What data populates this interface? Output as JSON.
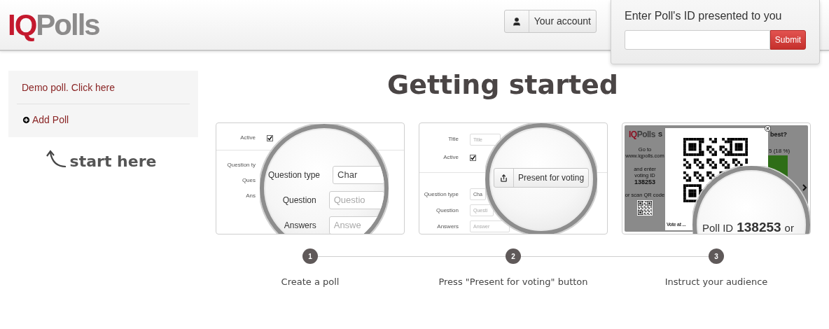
{
  "header": {
    "logo": {
      "accent": "IQ",
      "rest": "Polls"
    },
    "account_button": "Your account",
    "poll_entry": {
      "label": "Enter Poll's ID presented to you",
      "submit": "Submit"
    }
  },
  "sidebar": {
    "items": [
      {
        "kind": "link",
        "label": "Demo poll. Click here"
      },
      {
        "kind": "add",
        "label": "Add Poll"
      }
    ],
    "hint": "start here"
  },
  "title": "Getting started",
  "steps": [
    {
      "number": "1",
      "caption": "Create a poll",
      "screenshot": {
        "kind": "form",
        "rows": [
          {
            "kind": "checkbox",
            "label": "Active",
            "checked": true
          },
          {
            "kind": "label",
            "label": "Question ty"
          },
          {
            "kind": "label",
            "label": "Ques"
          },
          {
            "kind": "label",
            "label": "Ans"
          }
        ],
        "lens": {
          "kind": "rows",
          "rows": [
            {
              "label": "Question type",
              "value": "Char"
            },
            {
              "label": "Question",
              "placeholder": "Questio"
            },
            {
              "label": "Answers",
              "placeholder": "Answe"
            }
          ]
        }
      }
    },
    {
      "number": "2",
      "caption": "Press \"Present for voting\" button",
      "screenshot": {
        "kind": "form",
        "rows": [
          {
            "kind": "field",
            "label": "Title",
            "placeholder": "Title"
          },
          {
            "kind": "checkbox",
            "label": "Active",
            "checked": true
          },
          {
            "kind": "field",
            "label": "Question type",
            "value": "Cha"
          },
          {
            "kind": "field",
            "label": "Question",
            "placeholder": "Questi"
          },
          {
            "kind": "field",
            "label": "Answers",
            "placeholder": "Answer"
          }
        ],
        "lens": {
          "kind": "button",
          "label": "Present for voting"
        }
      }
    },
    {
      "number": "3",
      "caption": "Instruct your audience",
      "screenshot": {
        "kind": "presentation",
        "logo": {
          "accent": "IQ",
          "rest": "Polls"
        },
        "question_parts": [
          "S",
          "best?"
        ],
        "instructions": [
          "Go to",
          "www.iqpolls.com",
          "and enter",
          "voting ID"
        ],
        "voting_id": "138253",
        "scan_hint": "or scan QR code",
        "bar_label": "5 (18 %)",
        "modal_footer": "Vote at ...",
        "lens": {
          "label": "Poll ID",
          "value": "138253",
          "trailing": "or"
        }
      }
    }
  ]
}
